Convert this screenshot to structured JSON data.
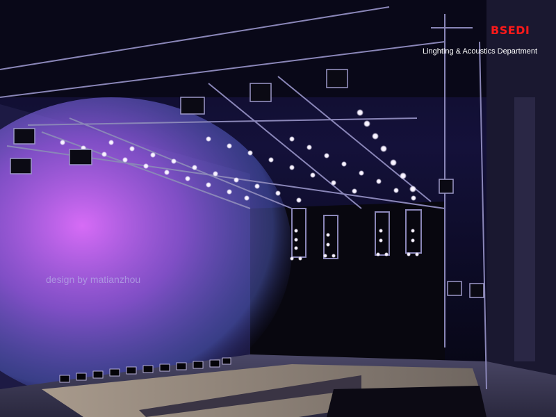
{
  "brand": {
    "name": "BSEDI",
    "department": "Linghting & Acoustics Department",
    "color": "#ff1a1a"
  },
  "credit": {
    "text": "design by matianzhou"
  },
  "palette": {
    "wash": "#d25cff",
    "wash_edge": "#6a78e0",
    "lamp": "#ffffff",
    "truss": "#8a86b8",
    "stage": "#8a7f78"
  }
}
